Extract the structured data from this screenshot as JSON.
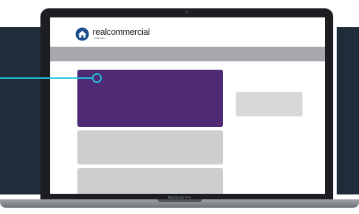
{
  "logo": {
    "name": "realcommercial",
    "domain": ".com.au",
    "icon": "house-icon"
  },
  "device": {
    "model": "MacBook Pro"
  },
  "colors": {
    "background_panel": "#1f2c3a",
    "featured_card": "#4e2b74",
    "nav_bar": "#a6a8ab",
    "pointer": "#1ec6e0",
    "logo_accent": "#1a4e8a"
  }
}
